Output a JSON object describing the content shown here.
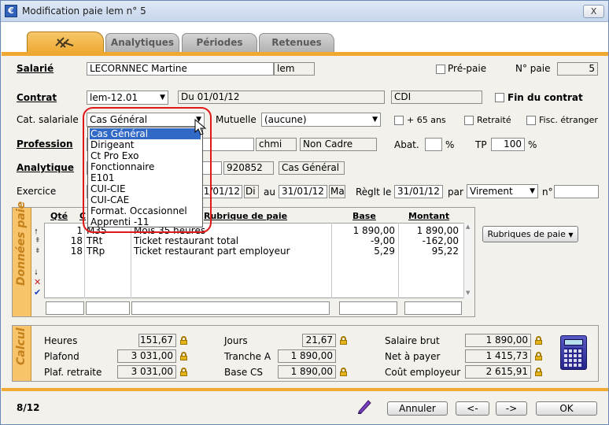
{
  "window": {
    "title": "Modification paie lem n° 5",
    "close": "X"
  },
  "tabs": [
    {
      "label": "Analytiques"
    },
    {
      "label": "Périodes"
    },
    {
      "label": "Retenues"
    }
  ],
  "salarie": {
    "label": "Salarié",
    "name": "LECORNNEC Martine",
    "code": "lem",
    "prepaie_label": "Pré-paie",
    "npaie_label": "N° paie",
    "npaie": "5"
  },
  "contrat": {
    "label": "Contrat",
    "value": "lem-12.01",
    "du": "Du 01/01/12",
    "type": "CDI",
    "fin_label": "Fin du contrat"
  },
  "cat": {
    "label": "Cat. salariale",
    "value": "Cas Général",
    "mutuelle_label": "Mutuelle",
    "mutuelle_value": "(aucune)",
    "plus65": "+ 65 ans",
    "retraite": "Retraité",
    "fisc": "Fisc. étranger"
  },
  "dropdown_options": [
    "Cas Général",
    "Dirigeant",
    "Ct Pro Exo",
    "Fonctionnaire",
    "E101",
    "CUI-CIE",
    "CUI-CAE",
    "Format. Occasionnel",
    "Apprenti -11"
  ],
  "profession": {
    "label": "Profession",
    "code": "chmi",
    "status": "Non Cadre",
    "abat_label": "Abat.",
    "abat_value": "",
    "pct": "%",
    "tp_label": "TP",
    "tp_value": "100"
  },
  "analytique": {
    "label": "Analytique",
    "code": "920852",
    "value": "Cas Général"
  },
  "exercice": {
    "label": "Exercice",
    "from": "01/01/12",
    "from_day": "Di",
    "au": "au",
    "to": "31/01/12",
    "to_day": "Ma",
    "reglt_label": "Règlt le",
    "reglt_date": "31/01/12",
    "par": "par",
    "mode": "Virement",
    "no_label": "n°"
  },
  "donnees": {
    "side_label": "Données paie",
    "headers": {
      "qte": "Qté",
      "c": "C",
      "rub": "Rubrique de paie",
      "base": "Base",
      "montant": "Montant"
    },
    "rows": [
      {
        "qte": "1",
        "code": "M35",
        "label": "Mois 35 heures",
        "base": "1 890,00",
        "montant": "1 890,00"
      },
      {
        "qte": "18",
        "code": "TRt",
        "label": "Ticket restaurant total",
        "base": "-9,00",
        "montant": "-162,00"
      },
      {
        "qte": "18",
        "code": "TRp",
        "label": "Ticket restaurant part employeur",
        "base": "5,29",
        "montant": "95,22"
      }
    ],
    "rubriques_button": "Rubriques de paie"
  },
  "calcul": {
    "side_label": "Calcul",
    "heures": {
      "label": "Heures",
      "value": "151,67"
    },
    "plafond": {
      "label": "Plafond",
      "value": "3 031,00"
    },
    "plaf_retraite": {
      "label": "Plaf. retraite",
      "value": "3 031,00"
    },
    "jours": {
      "label": "Jours",
      "value": "21,67"
    },
    "tranche_a": {
      "label": "Tranche A",
      "value": "1 890,00"
    },
    "base_cs": {
      "label": "Base CS",
      "value": "1 890,00"
    },
    "salaire_brut": {
      "label": "Salaire brut",
      "value": "1 890,00"
    },
    "net_payer": {
      "label": "Net à payer",
      "value": "1 415,73"
    },
    "cout_employeur": {
      "label": "Coût employeur",
      "value": "2 615,91"
    }
  },
  "footer": {
    "page": "8/12",
    "annuler": "Annuler",
    "prev": "<-",
    "next": "->",
    "ok": "OK"
  }
}
